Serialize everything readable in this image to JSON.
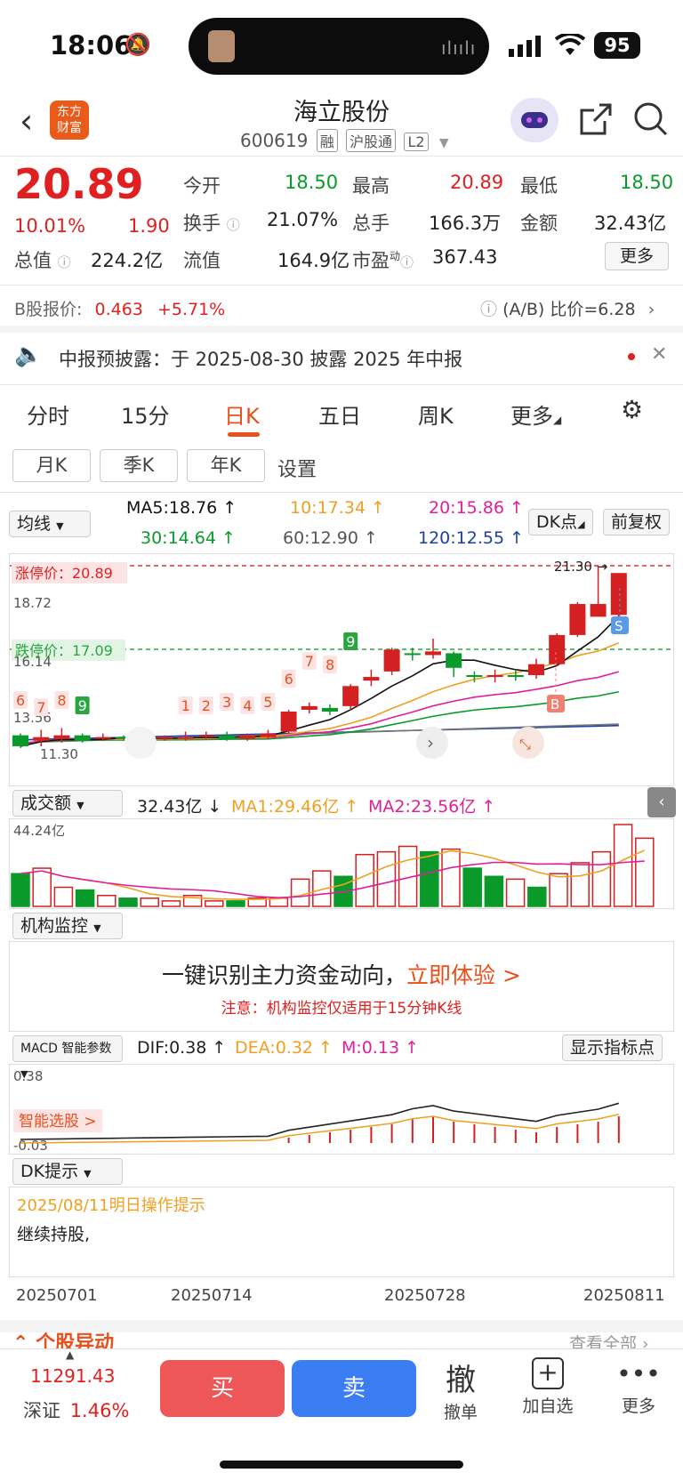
{
  "status": {
    "time": "18:06",
    "battery": "95"
  },
  "header": {
    "title": "海立股份",
    "code": "600619",
    "tags": [
      "融",
      "沪股通",
      "L2"
    ],
    "logo": "东方\n财富"
  },
  "quote": {
    "price": "20.89",
    "pct": "10.01%",
    "change": "1.90",
    "open_label": "今开",
    "open": "18.50",
    "high_label": "最高",
    "high": "20.89",
    "low_label": "最低",
    "low": "18.50",
    "turnover_label": "换手",
    "turnover": "21.07%",
    "volume_label": "总手",
    "volume": "166.3万",
    "amount_label": "金额",
    "amount": "32.43亿",
    "mcap_label": "总值",
    "mcap": "224.2亿",
    "float_label": "流值",
    "float": "164.9亿",
    "pe_label": "市盈",
    "pe_sup": "动",
    "pe": "367.43",
    "more": "更多"
  },
  "bshare": {
    "label": "B股报价:",
    "price": "0.463",
    "pct": "+5.71%",
    "ratio": "(A/B) 比价=6.28"
  },
  "notice": {
    "text": "中报预披露：于 2025-08-30 披露 2025 年中报"
  },
  "tabs": [
    "分时",
    "15分",
    "日K",
    "五日",
    "周K",
    "更多"
  ],
  "subtabs": [
    "月K",
    "季K",
    "年K",
    "设置"
  ],
  "ma": {
    "selector": "均线",
    "ma5": "MA5:18.76 ↑",
    "ma10": "10:17.34 ↑",
    "ma20": "20:15.86 ↑",
    "ma30": "30:14.64 ↑",
    "ma60": "60:12.90 ↑",
    "ma120": "120:12.55 ↑",
    "dk": "DK点",
    "fq": "前复权"
  },
  "kchart": {
    "ymax_label": "21.30",
    "y2": "18.72",
    "y3": "16.14",
    "y4": "13.56",
    "ymin_label": "11.30",
    "limit_up": "涨停价：20.89",
    "limit_down": "跌停价：17.09",
    "peak_label": "21.30",
    "counts": [
      "6",
      "7",
      "8",
      "9",
      "1",
      "2",
      "3",
      "4",
      "5",
      "6",
      "7",
      "8",
      "9"
    ],
    "b_mark": "B",
    "s_mark": "S"
  },
  "volume": {
    "selector": "成交额",
    "value": "32.43亿 ↓",
    "ma1": "MA1:29.46亿 ↑",
    "ma2": "MA2:23.56亿 ↑",
    "max_label": "44.24亿"
  },
  "inst": {
    "selector": "机构监控",
    "headline": "一键识别主力资金动向，",
    "cta": "立即体验 >",
    "note": "注意：机构监控仅适用于15分钟K线"
  },
  "macd": {
    "selector": "MACD 智能参数",
    "dif": "DIF:0.38 ↑",
    "dea": "DEA:0.32 ↑",
    "m": "M:0.13 ↑",
    "show": "显示指标点",
    "top": "0.38",
    "bottom": "-0.03",
    "smart": "智能选股 >"
  },
  "dk": {
    "selector": "DK提示",
    "date": "2025/08/11明日操作提示",
    "text": "继续持股,"
  },
  "dates": [
    "20250701",
    "20250714",
    "20250728",
    "20250811"
  ],
  "section_peek": {
    "left": "个股异动",
    "right": "查看全部"
  },
  "bottom": {
    "index_value": "11291.43",
    "index_name": "深证",
    "index_pct": "1.46%",
    "buy": "买",
    "sell": "卖",
    "cancel": "撤单",
    "cancel_icon": "撤",
    "add": "加自选",
    "more": "更多"
  }
}
